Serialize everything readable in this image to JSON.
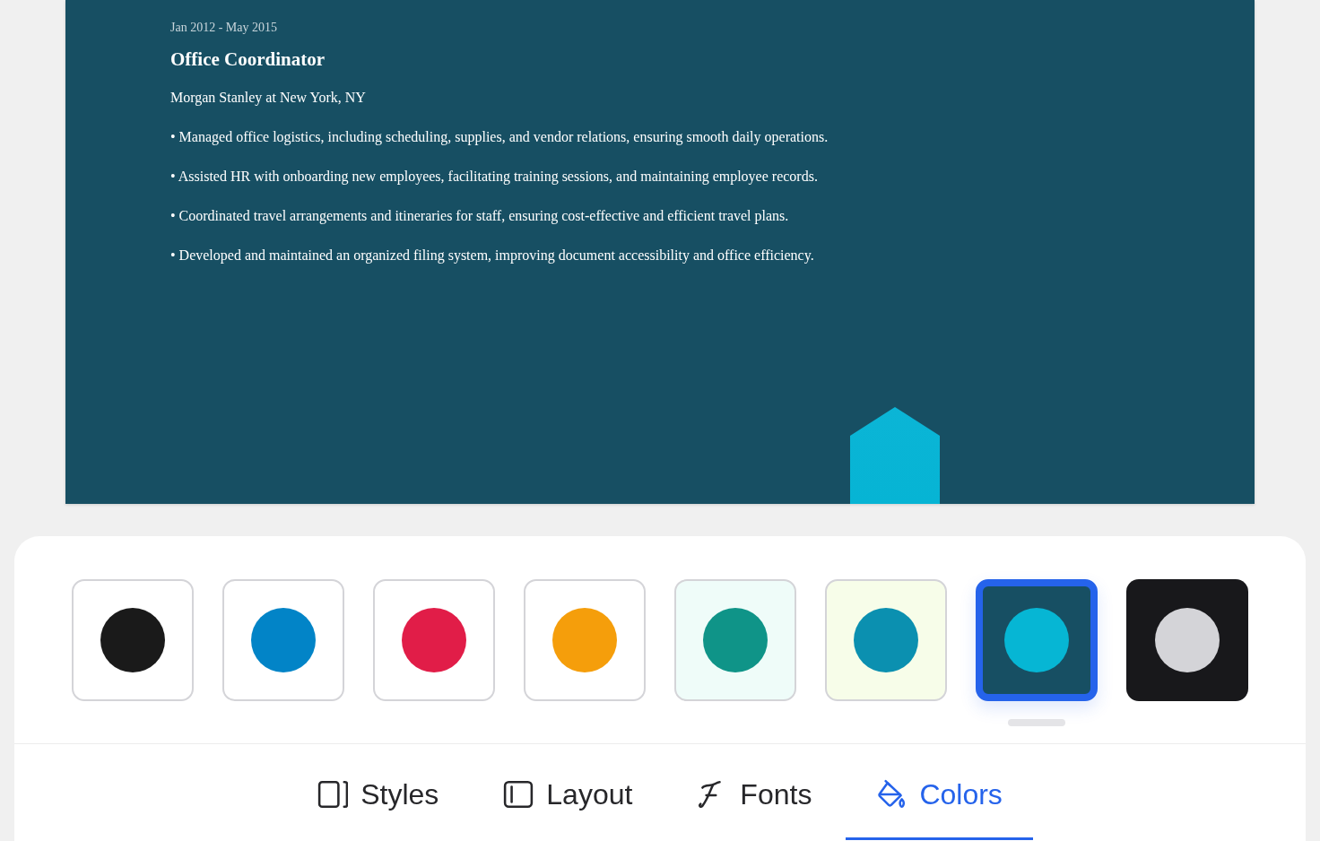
{
  "resume": {
    "date": "Jan 2012 - May 2015",
    "title": "Office Coordinator",
    "company": "Morgan Stanley at New York, NY",
    "bullets": [
      "• Managed office logistics, including scheduling, supplies, and vendor relations, ensuring smooth daily operations.",
      "• Assisted HR with onboarding new employees, facilitating training sessions, and maintaining employee records.",
      "• Coordinated travel arrangements and itineraries for staff, ensuring cost-effective and efficient travel plans.",
      "• Developed and maintained an organized filing system, improving document accessibility and office efficiency."
    ]
  },
  "swatches": [
    {
      "tile": {
        "color": "#ffffff"
      },
      "dot": {
        "color": "#1a1a1a"
      },
      "selected": false
    },
    {
      "tile": {
        "color": "#ffffff"
      },
      "dot": {
        "color": "#0284c7"
      },
      "selected": false
    },
    {
      "tile": {
        "color": "#ffffff"
      },
      "dot": {
        "color": "#e11d48"
      },
      "selected": false
    },
    {
      "tile": {
        "color": "#ffffff"
      },
      "dot": {
        "color": "#f59e0b"
      },
      "selected": false
    },
    {
      "tile": {
        "color": "#effcf9"
      },
      "dot": {
        "color": "#0f9488"
      },
      "selected": false
    },
    {
      "tile": {
        "color": "#f7fde9"
      },
      "dot": {
        "color": "#0b90b0"
      },
      "selected": false
    },
    {
      "tile": {
        "color": "#174f63"
      },
      "dot": {
        "color": "#06b6d4"
      },
      "selected": true
    },
    {
      "tile": {
        "color": "#18181b"
      },
      "dot": {
        "color": "#d4d4d8"
      },
      "selected": false
    }
  ],
  "tabs": [
    {
      "kind": "styles",
      "label": "Styles",
      "selected": false
    },
    {
      "kind": "layout",
      "label": "Layout",
      "selected": false
    },
    {
      "kind": "fonts",
      "label": "Fonts",
      "selected": false
    },
    {
      "kind": "colors",
      "label": "Colors",
      "selected": true
    }
  ]
}
